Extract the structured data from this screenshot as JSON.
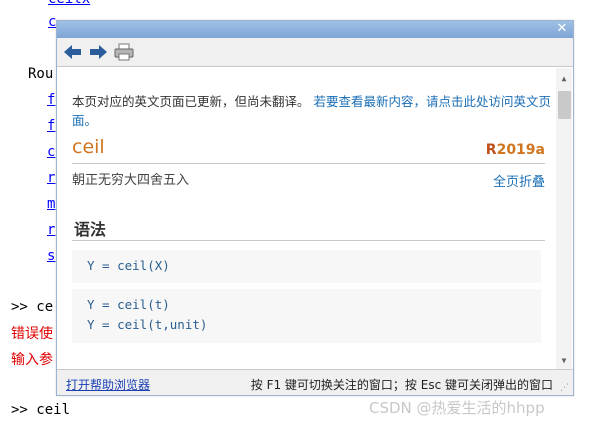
{
  "background": {
    "top_line_1": "                                        ",
    "top_line_2": "c",
    "routines_label": "Rou",
    "side_links": [
      "f",
      "f",
      "c",
      "r",
      "m",
      "r",
      "s"
    ],
    "prompt1": ">> ce",
    "error1": "错误使",
    "error2": "输入参",
    "prompt2": ">> ceil"
  },
  "popup": {
    "close_label": "✕",
    "toolbar": {
      "back_icon": "back-arrow-icon",
      "forward_icon": "forward-arrow-icon",
      "print_icon": "printer-icon"
    },
    "notice_text": "本页对应的英文页面已更新，但尚未翻译。",
    "notice_link": "若要查看最新内容，请点击此处访问英文页面。",
    "function_name": "ceil",
    "release_prefix": "R",
    "release_label": "2019a",
    "purpose": "朝正无穷大四舍五入",
    "collapse_all": "全页折叠",
    "syntax_heading": "语法",
    "syntax_blocks": [
      [
        "Y = ceil(X)"
      ],
      [
        "Y = ceil(t)",
        "Y = ceil(t,unit)"
      ]
    ],
    "footer_link": "打开帮助浏览器",
    "footer_hint": "按 F1 键可切换关注的窗口；按 Esc 键可关闭弹出的窗口"
  },
  "watermark": "CSDN @热爱生活的hhpp",
  "colors": {
    "title_orange": "#d17620",
    "link_blue": "#1a6fb6",
    "error_red": "#e00000",
    "titlebar_blue": "#8fb2de"
  }
}
